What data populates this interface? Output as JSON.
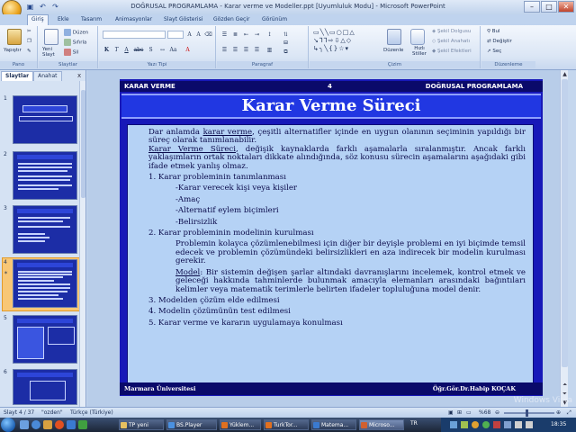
{
  "window": {
    "title": "DOĞRUSAL PROGRAMLAMA - Karar verme ve Modeller.ppt [Uyumluluk Modu] - Microsoft PowerPoint",
    "minimize": "–",
    "maximize": "□",
    "close": "✕"
  },
  "ribbon_tabs": [
    "Giriş",
    "Ekle",
    "Tasarım",
    "Animasyonlar",
    "Slayt Gösterisi",
    "Gözden Geçir",
    "Görünüm"
  ],
  "ribbon": {
    "clipboard": {
      "paste": "Yapıştır",
      "label": "Pano"
    },
    "slides": {
      "new_slide": "Yeni Slayt",
      "layout": "Düzen",
      "reset": "Sıfırla",
      "delete": "Sil",
      "label": "Slaytlar"
    },
    "font": {
      "label": "Yazı Tipi",
      "font_value": "",
      "size_value": "",
      "bold": "K",
      "italic": "T",
      "underline": "A",
      "strike": "abc",
      "shadow": "S"
    },
    "paragraph": {
      "label": "Paragraf"
    },
    "drawing": {
      "arrange": "Düzenle",
      "quick_styles": "Hızlı Stiller",
      "shape_fill": "Şekil Dolgusu",
      "shape_outline": "Şekil Anahatı",
      "shape_effects": "Şekil Efektleri",
      "label": "Çizim"
    },
    "editing": {
      "find": "Bul",
      "replace": "Değiştir",
      "select": "Seç",
      "label": "Düzenleme"
    }
  },
  "left_pane": {
    "tabs": [
      "Slaytlar",
      "Anahat"
    ],
    "close": "x",
    "slide_numbers": [
      "1",
      "2",
      "3",
      "4",
      "5",
      "6"
    ],
    "selected_index": 3
  },
  "slide": {
    "header_left": "KARAR VERME",
    "header_center": "4",
    "header_right": "DOĞRUSAL PROGRAMLAMA",
    "title": "Karar Verme Süreci",
    "p1_pre": "Dar anlamda ",
    "p1_u": "karar verme",
    "p1_post": ", çeşitli alternatifler içinde en uygun olanının seçiminin yapıldığı bir süreç olarak tanımlanabilir.",
    "p2_u": "Karar Verme Süreci",
    "p2_post": ", değişik kaynaklarda farklı aşamalarla sıralanmıştır. Ancak farklı yaklaşımların ortak noktaları dikkate alındığında, söz konusu sürecin aşamalarını aşağıdaki gibi ifade etmek yanlış olmaz.",
    "item1": "1. Karar probleminin tanımlanması",
    "sub1": [
      "-Karar verecek kişi veya kişiler",
      "-Amaç",
      "-Alternatif eylem biçimleri",
      "-Belirsizlik"
    ],
    "item2": "2.  Karar probleminin modelinin kurulması",
    "item2_text": "Problemin kolayca çözümlenebilmesi için diğer bir deyişle problemi en iyi biçimde temsil      edecek ve problemin çözümündeki belirsizlikleri en aza indirecek bir modelin kurulması  gerekir.",
    "model_u": "Model",
    "model_text": ": Bir sistemin değişen şarlar altındaki davranışlarını incelemek, kontrol etmek ve geleceği hakkında tahminlerde bulunmak amacıyla elemanları arasındaki bağıntıları kelimler veya matematik terimlerle belirten ifadeler topluluğuna model denir.",
    "item3": "3. Modelden çözüm elde edilmesi",
    "item4": "4. Modelin çözümünün test edilmesi",
    "item5": "5. Karar verme ve kararın uygulamaya konulması",
    "footer_left": "Marmara Üniversitesi",
    "footer_right": "Öğr.Gör.Dr.Habip  KOÇAK"
  },
  "statusbar": {
    "slide_count": "Slayt 4 / 37",
    "theme": "\"ozden\"",
    "language": "Türkçe (Türkiye)",
    "zoom": "%68"
  },
  "taskbar": {
    "items": [
      "TP yeni",
      "BS.Player",
      "Yüklem...",
      "TurkTor...",
      "Matema...",
      "Microso..."
    ],
    "lang": "TR",
    "time": "18:35"
  },
  "watermark": "Windows Vista"
}
